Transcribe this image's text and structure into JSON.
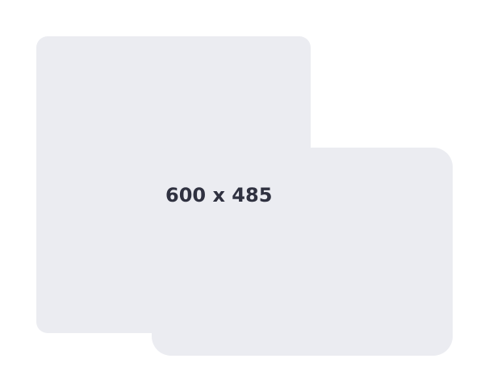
{
  "placeholder": {
    "label": "600 x 485",
    "shape_color": "#ebecf1",
    "text_color": "#2f3140",
    "background_color": "#ffffff"
  }
}
